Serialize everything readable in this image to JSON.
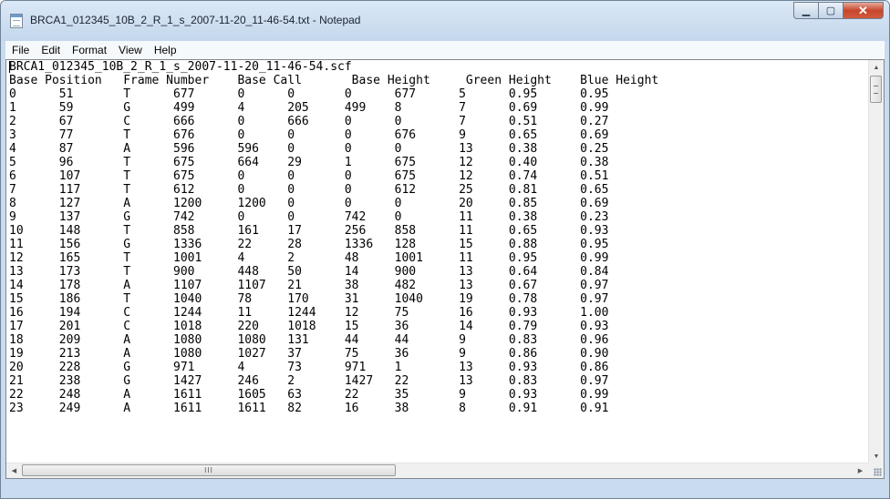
{
  "window": {
    "title": "BRCA1_012345_10B_2_R_1_s_2007-11-20_11-46-54.txt - Notepad",
    "buttons": {
      "minimize": "▁",
      "maximize": "▢",
      "close": "✕"
    }
  },
  "menu": {
    "items": [
      "File",
      "Edit",
      "Format",
      "View",
      "Help"
    ]
  },
  "document": {
    "lines": [
      "BRCA1_012345_10B_2_R_1_s_2007-11-20_11-46-54.scf",
      "Base Position   Frame Number    Base Call       Base Height     Green Height    Blue Height",
      "0      51       T      677      0      0       0      677      5      0.95      0.95",
      "1      59       G      499      4      205     499    8        7      0.69      0.99",
      "2      67       C      666      0      666     0      0        7      0.51      0.27",
      "3      77       T      676      0      0       0      676      9      0.65      0.69",
      "4      87       A      596      596    0       0      0        13     0.38      0.25",
      "5      96       T      675      664    29      1      675      12     0.40      0.38",
      "6      107      T      675      0      0       0      675      12     0.74      0.51",
      "7      117      T      612      0      0       0      612      25     0.81      0.65",
      "8      127      A      1200     1200   0       0      0        20     0.85      0.69",
      "9      137      G      742      0      0       742    0        11     0.38      0.23",
      "10     148      T      858      161    17      256    858      11     0.65      0.93",
      "11     156      G      1336     22     28      1336   128      15     0.88      0.95",
      "12     165      T      1001     4      2       48     1001     11     0.95      0.99",
      "13     173      T      900      448    50      14     900      13     0.64      0.84",
      "14     178      A      1107     1107   21      38     482      13     0.67      0.97",
      "15     186      T      1040     78     170     31     1040     19     0.78      0.97",
      "16     194      C      1244     11     1244    12     75       16     0.93      1.00",
      "17     201      C      1018     220    1018    15     36       14     0.79      0.93",
      "18     209      A      1080     1080   131     44     44       9      0.83      0.96",
      "19     213      A      1080     1027   37      75     36       9      0.86      0.90",
      "20     228      G      971      4      73      971    1        13     0.93      0.86",
      "21     238      G      1427     246    2       1427   22       13     0.83      0.97",
      "22     248      A      1611     1605   63      22     35       9      0.93      0.99",
      "23     249      A      1611     1611   82      16     38       8      0.91      0.91"
    ]
  },
  "scrollbars": {
    "horizontal": {
      "thumb_grip": "III"
    }
  }
}
